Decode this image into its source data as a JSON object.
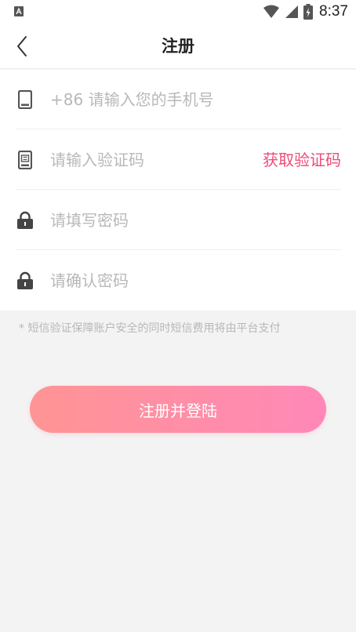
{
  "status_bar": {
    "time": "8:37"
  },
  "header": {
    "title": "注册"
  },
  "form": {
    "phone_placeholder": "+86 请输入您的手机号",
    "code_placeholder": "请输入验证码",
    "get_code_label": "获取验证码",
    "password_placeholder": "请填写密码",
    "confirm_password_placeholder": "请确认密码"
  },
  "notice": "* 短信验证保障账户安全的同时短信费用将由平台支付",
  "submit_label": "注册并登陆",
  "colors": {
    "accent": "#ee4a7a",
    "button_gradient_start": "#ff9494",
    "button_gradient_end": "#ff88b8",
    "placeholder": "#b8b8b8",
    "background": "#f3f3f3"
  }
}
